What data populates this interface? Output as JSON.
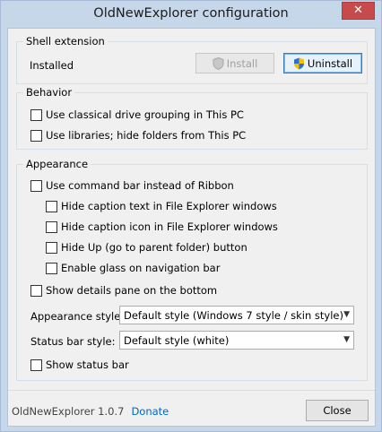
{
  "window": {
    "title": "OldNewExplorer configuration"
  },
  "shell_extension": {
    "group_label": "Shell extension",
    "status": "Installed",
    "install_label": "Install",
    "uninstall_label": "Uninstall"
  },
  "behavior": {
    "group_label": "Behavior",
    "options": [
      {
        "label": "Use classical drive grouping in This PC",
        "checked": false
      },
      {
        "label": "Use libraries; hide folders from This PC",
        "checked": false
      }
    ]
  },
  "appearance": {
    "group_label": "Appearance",
    "command_bar": {
      "label": "Use command bar instead of Ribbon",
      "checked": false
    },
    "sub_options": [
      {
        "label": "Hide caption text in File Explorer windows",
        "checked": false
      },
      {
        "label": "Hide caption icon in File Explorer windows",
        "checked": false
      },
      {
        "label": "Hide Up (go to parent folder) button",
        "checked": false
      },
      {
        "label": "Enable glass on navigation bar",
        "checked": false
      }
    ],
    "details_pane": {
      "label": "Show details pane on the bottom",
      "checked": false
    },
    "style_label": "Appearance style:",
    "style_value": "Default style (Windows 7 style / skin style)",
    "status_bar_style_label": "Status bar style:",
    "status_bar_style_value": "Default style (white)",
    "show_status_bar": {
      "label": "Show status bar",
      "checked": false
    }
  },
  "footer": {
    "version": "OldNewExplorer 1.0.7",
    "donate": "Donate",
    "close_label": "Close"
  }
}
